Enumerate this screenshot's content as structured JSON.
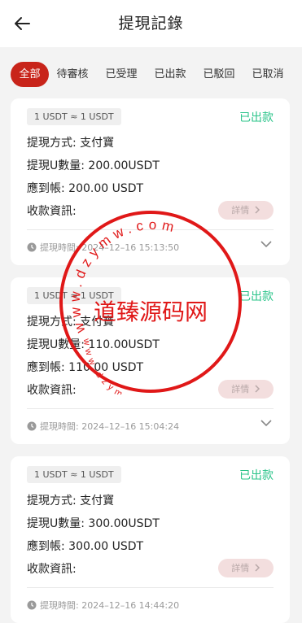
{
  "header": {
    "title": "提現記錄"
  },
  "tabs": [
    {
      "label": "全部",
      "active": true
    },
    {
      "label": "待審核",
      "active": false
    },
    {
      "label": "已受理",
      "active": false
    },
    {
      "label": "已出款",
      "active": false
    },
    {
      "label": "已駁回",
      "active": false
    },
    {
      "label": "已取消",
      "active": false
    }
  ],
  "records": [
    {
      "rate": "1 USDT ≈ 1 USDT",
      "status": "已出款",
      "method": "提現方式: 支付寶",
      "amount": "提現U數量: 200.00USDT",
      "received": "應到帳: 200.00 USDT",
      "payment_info": "收款資訊:",
      "detail_label": "詳情",
      "time": "提現時間: 2024–12–16 15:13:50"
    },
    {
      "rate": "1 USDT ≈ 1 USDT",
      "status": "已出款",
      "method": "提現方式: 支付寶",
      "amount": "提現U數量: 110.00USDT",
      "received": "應到帳: 110.00 USDT",
      "payment_info": "收款資訊:",
      "detail_label": "詳情",
      "time": "提現時間: 2024–12–16 15:04:24"
    },
    {
      "rate": "1 USDT ≈ 1 USDT",
      "status": "已出款",
      "method": "提現方式: 支付寶",
      "amount": "提現U數量: 300.00USDT",
      "received": "應到帳: 300.00 USDT",
      "payment_info": "收款資訊:",
      "detail_label": "詳情",
      "time": "提現時間: 2024–12–16 14:44:20"
    }
  ],
  "watermark": {
    "center_text": "道臻源码网",
    "upper_arc_text": "www.dzymw.com",
    "lower_arc_text": "www.dzymw.com",
    "color": "#e01818"
  },
  "colors": {
    "accent": "#c8241a",
    "status_green": "#2bc48a",
    "detail_btn_bg": "#f3dede"
  }
}
